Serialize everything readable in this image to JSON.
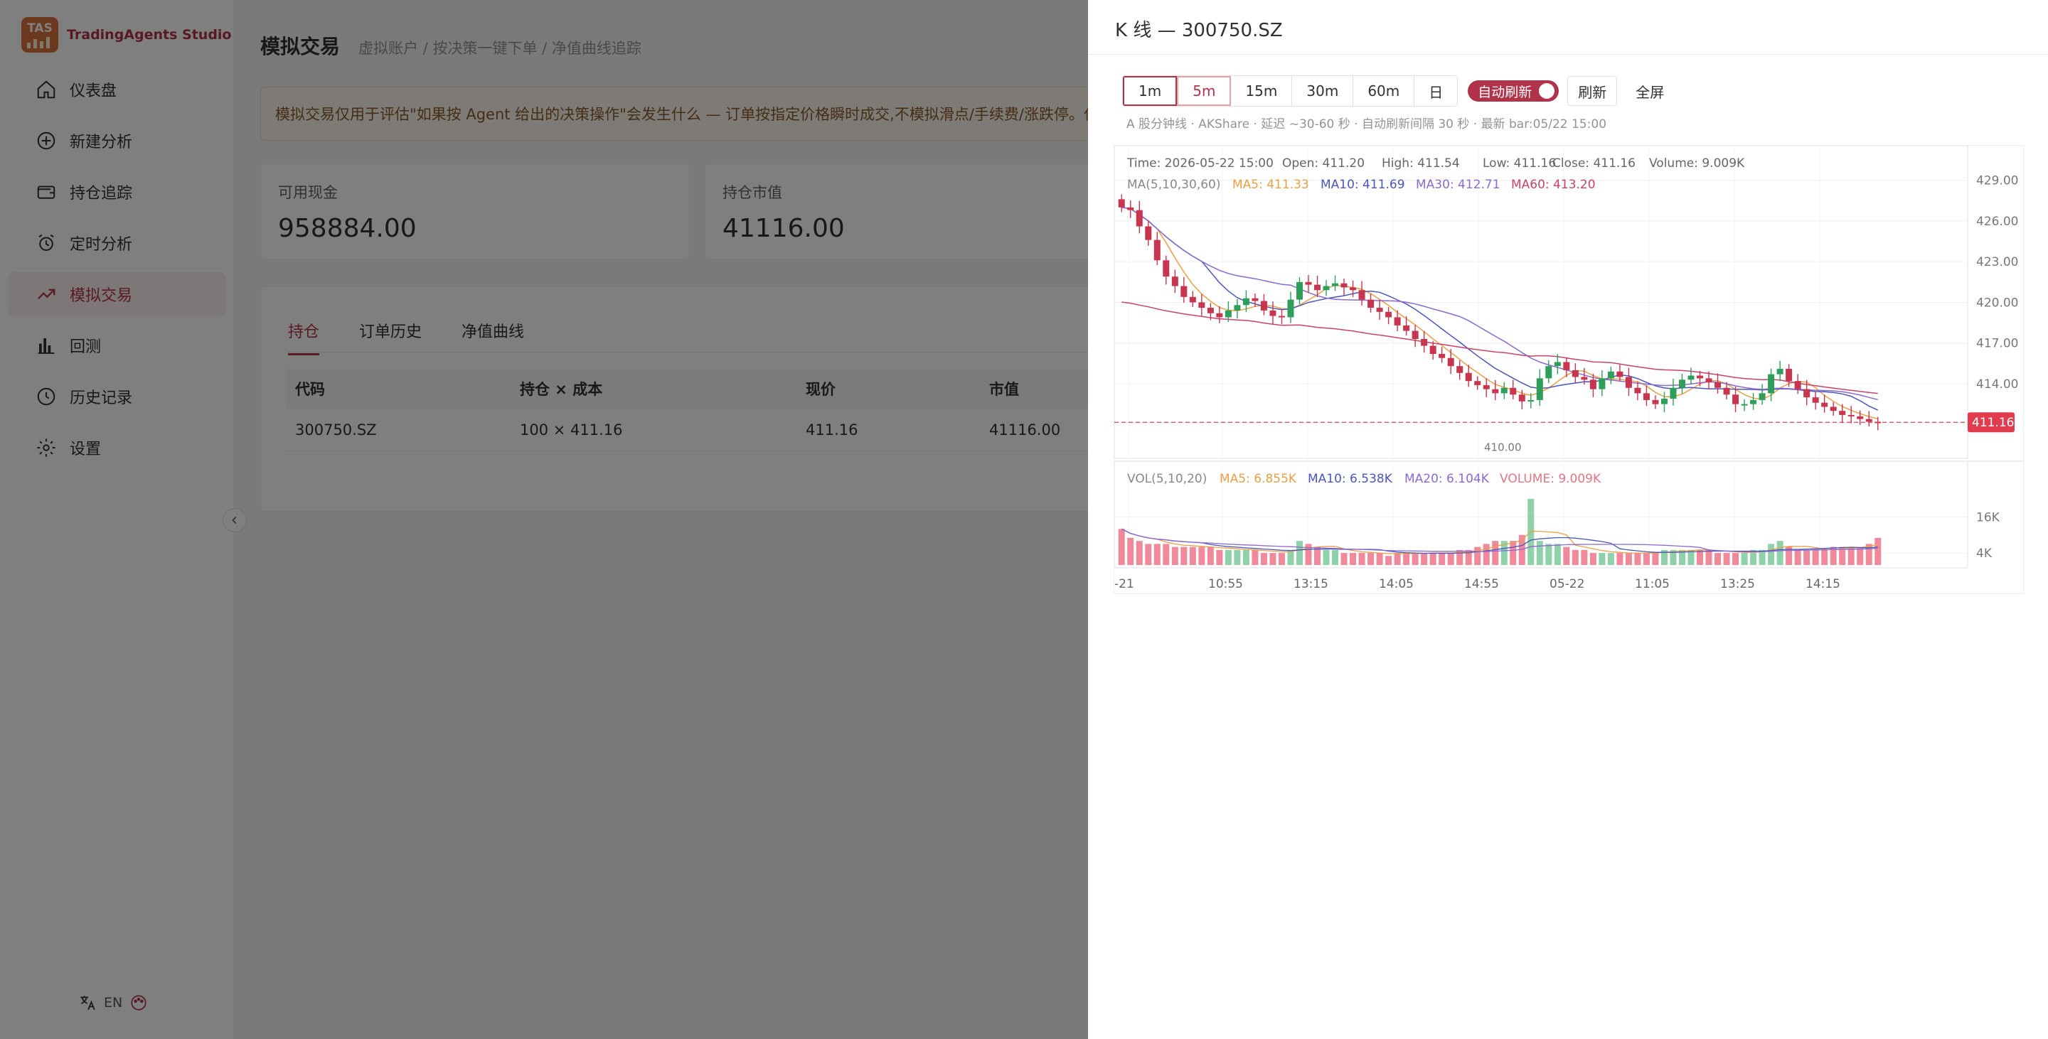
{
  "app": {
    "logo_text": "TAS",
    "name": "TradingAgents Studio"
  },
  "sidebar": {
    "items": [
      {
        "label": "仪表盘",
        "icon": "home-icon"
      },
      {
        "label": "新建分析",
        "icon": "plus-circle-icon"
      },
      {
        "label": "持仓追踪",
        "icon": "wallet-icon"
      },
      {
        "label": "定时分析",
        "icon": "alarm-clock-icon"
      },
      {
        "label": "模拟交易",
        "icon": "trend-up-icon",
        "active": true
      },
      {
        "label": "回测",
        "icon": "bar-chart-icon"
      },
      {
        "label": "历史记录",
        "icon": "clock-icon"
      },
      {
        "label": "设置",
        "icon": "gear-icon"
      }
    ],
    "footer": {
      "lang_label": "EN"
    }
  },
  "page": {
    "title": "模拟交易",
    "subtitle": "虚拟账户 / 按决策一键下单 / 净值曲线追踪",
    "notice": "模拟交易仅用于评估\"如果按 Agent 给出的决策操作\"会发生什么 — 订单按指定价格瞬时成交,不模拟滑点/手续费/涨跌停。任"
  },
  "cards": [
    {
      "label": "可用现金",
      "value": "958884.00"
    },
    {
      "label": "持仓市值",
      "value": "41116.00"
    }
  ],
  "tabs": [
    "持仓",
    "订单历史",
    "净值曲线"
  ],
  "table": {
    "headers": [
      "代码",
      "持仓 × 成本",
      "现价",
      "市值"
    ],
    "rows": [
      [
        "300750.SZ",
        "100 × 411.16",
        "411.16",
        "41116.00"
      ]
    ]
  },
  "drawer": {
    "title": "K 线 — 300750.SZ",
    "periods": [
      "1m",
      "5m",
      "15m",
      "30m",
      "60m",
      "日"
    ],
    "selected_period": "1m",
    "current_period": "5m",
    "auto_refresh_label": "自动刷新",
    "refresh_label": "刷新",
    "fullscreen_label": "全屏",
    "info": "A 股分钟线 · AKShare · 延迟 ~30-60 秒 · 自动刷新间隔 30 秒 · 最新 bar:05/22 15:00"
  },
  "chart_data": {
    "type": "candlestick",
    "colors": {
      "up": "#2e9e5a",
      "down": "#c8354e",
      "ma5": "#e8a046",
      "ma10": "#4a57b8",
      "ma30": "#8a6ad0",
      "ma60": "#c8426a",
      "last_price": "#e03c4e"
    },
    "tooltip": {
      "time": "Time: 2026-05-22 15:00",
      "open": "Open: 411.20",
      "high": "High: 411.54",
      "low": "Low: 411.16",
      "close": "Close: 411.16",
      "volume": "Volume: 9.009K"
    },
    "ma_legend": {
      "title": "MA(5,10,30,60)",
      "ma5": "MA5: 411.33",
      "ma10": "MA10: 411.69",
      "ma30": "MA30: 412.71",
      "ma60": "MA60: 413.20"
    },
    "vol_legend": {
      "title": "VOL(5,10,20)",
      "ma5": "MA5: 6.855K",
      "ma10": "MA10: 6.538K",
      "ma20": "MA20: 6.104K",
      "volume": "VOLUME: 9.009K"
    },
    "price_ticks": [
      "429.00",
      "426.00",
      "423.00",
      "420.00",
      "417.00",
      "414.00"
    ],
    "price_tick_values": [
      429,
      426,
      423,
      420,
      417,
      414
    ],
    "price_range": [
      408.5,
      430.5
    ],
    "last_price": 411.16,
    "last_price_label": "411.16",
    "low_marker": 410.0,
    "low_marker_label": "410.00",
    "volume_ticks": [
      "16K",
      "4K"
    ],
    "volume_tick_values": [
      16,
      4
    ],
    "volume_range": [
      0,
      26
    ],
    "x_ticks": [
      "-21",
      "10:55",
      "13:15",
      "14:05",
      "14:55",
      "05-22",
      "11:05",
      "13:25",
      "14:15"
    ],
    "closes": [
      427.0,
      426.8,
      425.6,
      424.6,
      423.1,
      421.9,
      421.2,
      420.4,
      420.0,
      419.6,
      419.2,
      418.9,
      419.4,
      419.8,
      420.3,
      420.1,
      419.4,
      419.0,
      418.9,
      420.2,
      421.5,
      421.3,
      420.9,
      421.2,
      421.4,
      421.1,
      420.9,
      420.2,
      419.6,
      419.3,
      418.9,
      418.3,
      417.9,
      417.3,
      416.8,
      416.2,
      415.9,
      415.3,
      414.8,
      414.2,
      413.9,
      413.6,
      413.3,
      413.7,
      413.2,
      412.7,
      412.8,
      414.4,
      415.3,
      415.6,
      415.0,
      414.5,
      414.3,
      413.6,
      414.4,
      414.9,
      414.5,
      413.7,
      413.3,
      412.8,
      412.5,
      412.9,
      413.7,
      414.3,
      414.6,
      414.4,
      414.1,
      413.7,
      413.2,
      412.5,
      412.5,
      412.8,
      413.3,
      414.7,
      415.1,
      414.2,
      413.6,
      413.0,
      412.6,
      412.3,
      412.0,
      411.7,
      411.6,
      411.4,
      411.2,
      411.16
    ],
    "volumes": [
      12,
      9,
      8,
      7,
      7,
      7,
      6,
      6,
      6,
      6,
      6,
      5,
      5,
      5,
      5,
      5,
      4,
      4,
      4,
      5,
      8,
      7,
      6,
      5,
      5,
      4,
      4,
      4,
      4,
      4,
      3,
      4,
      4,
      4,
      4,
      4,
      4,
      4,
      5,
      5,
      6,
      7,
      8,
      8,
      8,
      10,
      22,
      8,
      7,
      7,
      6,
      5,
      5,
      4,
      4,
      4,
      4,
      4,
      4,
      4,
      4,
      5,
      5,
      5,
      5,
      5,
      5,
      4,
      4,
      4,
      4,
      5,
      5,
      7,
      8,
      6,
      5,
      5,
      5,
      5,
      6,
      6,
      6,
      6,
      7,
      9
    ]
  }
}
